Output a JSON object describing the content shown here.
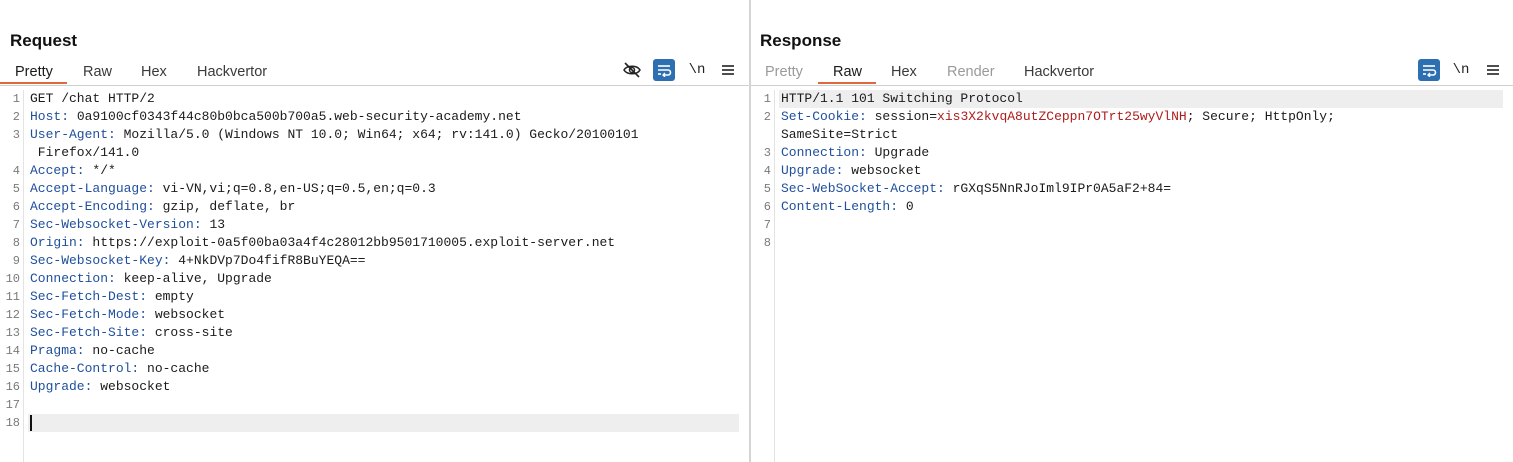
{
  "request": {
    "title": "Request",
    "tabs": [
      {
        "label": "Pretty",
        "active": true,
        "disabled": false
      },
      {
        "label": "Raw",
        "active": false,
        "disabled": false
      },
      {
        "label": "Hex",
        "active": false,
        "disabled": false
      },
      {
        "label": "Hackvertor",
        "active": false,
        "disabled": false
      }
    ],
    "toolbar": {
      "newline_label": "\\n",
      "icons": [
        "eye-slash-icon",
        "wrap-icon",
        "menu-icon"
      ]
    },
    "lines": [
      {
        "n": "1",
        "k": "",
        "v": "GET /chat HTTP/2"
      },
      {
        "n": "2",
        "k": "Host:",
        "v": " 0a9100cf0343f44c80b0bca500b700a5.web-security-academy.net"
      },
      {
        "n": "3",
        "k": "User-Agent:",
        "v": " Mozilla/5.0 (Windows NT 10.0; Win64; x64; rv:141.0) Gecko/20100101"
      },
      {
        "n": "",
        "k": "",
        "v": " Firefox/141.0"
      },
      {
        "n": "4",
        "k": "Accept:",
        "v": " */*"
      },
      {
        "n": "5",
        "k": "Accept-Language:",
        "v": " vi-VN,vi;q=0.8,en-US;q=0.5,en;q=0.3"
      },
      {
        "n": "6",
        "k": "Accept-Encoding:",
        "v": " gzip, deflate, br"
      },
      {
        "n": "7",
        "k": "Sec-Websocket-Version:",
        "v": " 13"
      },
      {
        "n": "8",
        "k": "Origin:",
        "v": " https://exploit-0a5f00ba03a4f4c28012bb9501710005.exploit-server.net"
      },
      {
        "n": "9",
        "k": "Sec-Websocket-Key:",
        "v": " 4+NkDVp7Do4fifR8BuYEQA=="
      },
      {
        "n": "10",
        "k": "Connection:",
        "v": " keep-alive, Upgrade"
      },
      {
        "n": "11",
        "k": "Sec-Fetch-Dest:",
        "v": " empty"
      },
      {
        "n": "12",
        "k": "Sec-Fetch-Mode:",
        "v": " websocket"
      },
      {
        "n": "13",
        "k": "Sec-Fetch-Site:",
        "v": " cross-site"
      },
      {
        "n": "14",
        "k": "Pragma:",
        "v": " no-cache"
      },
      {
        "n": "15",
        "k": "Cache-Control:",
        "v": " no-cache"
      },
      {
        "n": "16",
        "k": "Upgrade:",
        "v": " websocket"
      },
      {
        "n": "17",
        "k": "",
        "v": ""
      },
      {
        "n": "18",
        "k": "",
        "v": ""
      }
    ]
  },
  "response": {
    "title": "Response",
    "tabs": [
      {
        "label": "Pretty",
        "active": false,
        "disabled": true
      },
      {
        "label": "Raw",
        "active": true,
        "disabled": false
      },
      {
        "label": "Hex",
        "active": false,
        "disabled": false
      },
      {
        "label": "Render",
        "active": false,
        "disabled": true
      },
      {
        "label": "Hackvertor",
        "active": false,
        "disabled": false
      }
    ],
    "toolbar": {
      "newline_label": "\\n",
      "icons": [
        "wrap-icon",
        "menu-icon"
      ]
    },
    "lines": [
      {
        "n": "1",
        "k": "",
        "v": "HTTP/1.1 101 Switching Protocol"
      },
      {
        "n": "2",
        "k": "Set-Cookie:",
        "v": " session=",
        "cv": "xis3X2kvqA8utZCeppn7OTrt25wyVlNH",
        "v2": "; Secure; HttpOnly;"
      },
      {
        "n": "",
        "k": "",
        "v": "SameSite=Strict"
      },
      {
        "n": "3",
        "k": "Connection:",
        "v": " Upgrade"
      },
      {
        "n": "4",
        "k": "Upgrade:",
        "v": " websocket"
      },
      {
        "n": "5",
        "k": "Sec-WebSocket-Accept:",
        "v": " rGXqS5NnRJoIml9IPr0A5aF2+84="
      },
      {
        "n": "6",
        "k": "Content-Length:",
        "v": " 0"
      },
      {
        "n": "7",
        "k": "",
        "v": ""
      },
      {
        "n": "8",
        "k": "",
        "v": ""
      }
    ]
  },
  "layout_toggle": {
    "options": [
      "split-vertical-icon",
      "split-horizontal-icon",
      "single-pane-icon"
    ],
    "selected": "split-vertical-icon"
  },
  "colors": {
    "accent": "#2e6fb2",
    "tab_underline": "#e0683c",
    "header_key": "#1f4f9c",
    "cookie_value": "#b01c1c"
  }
}
